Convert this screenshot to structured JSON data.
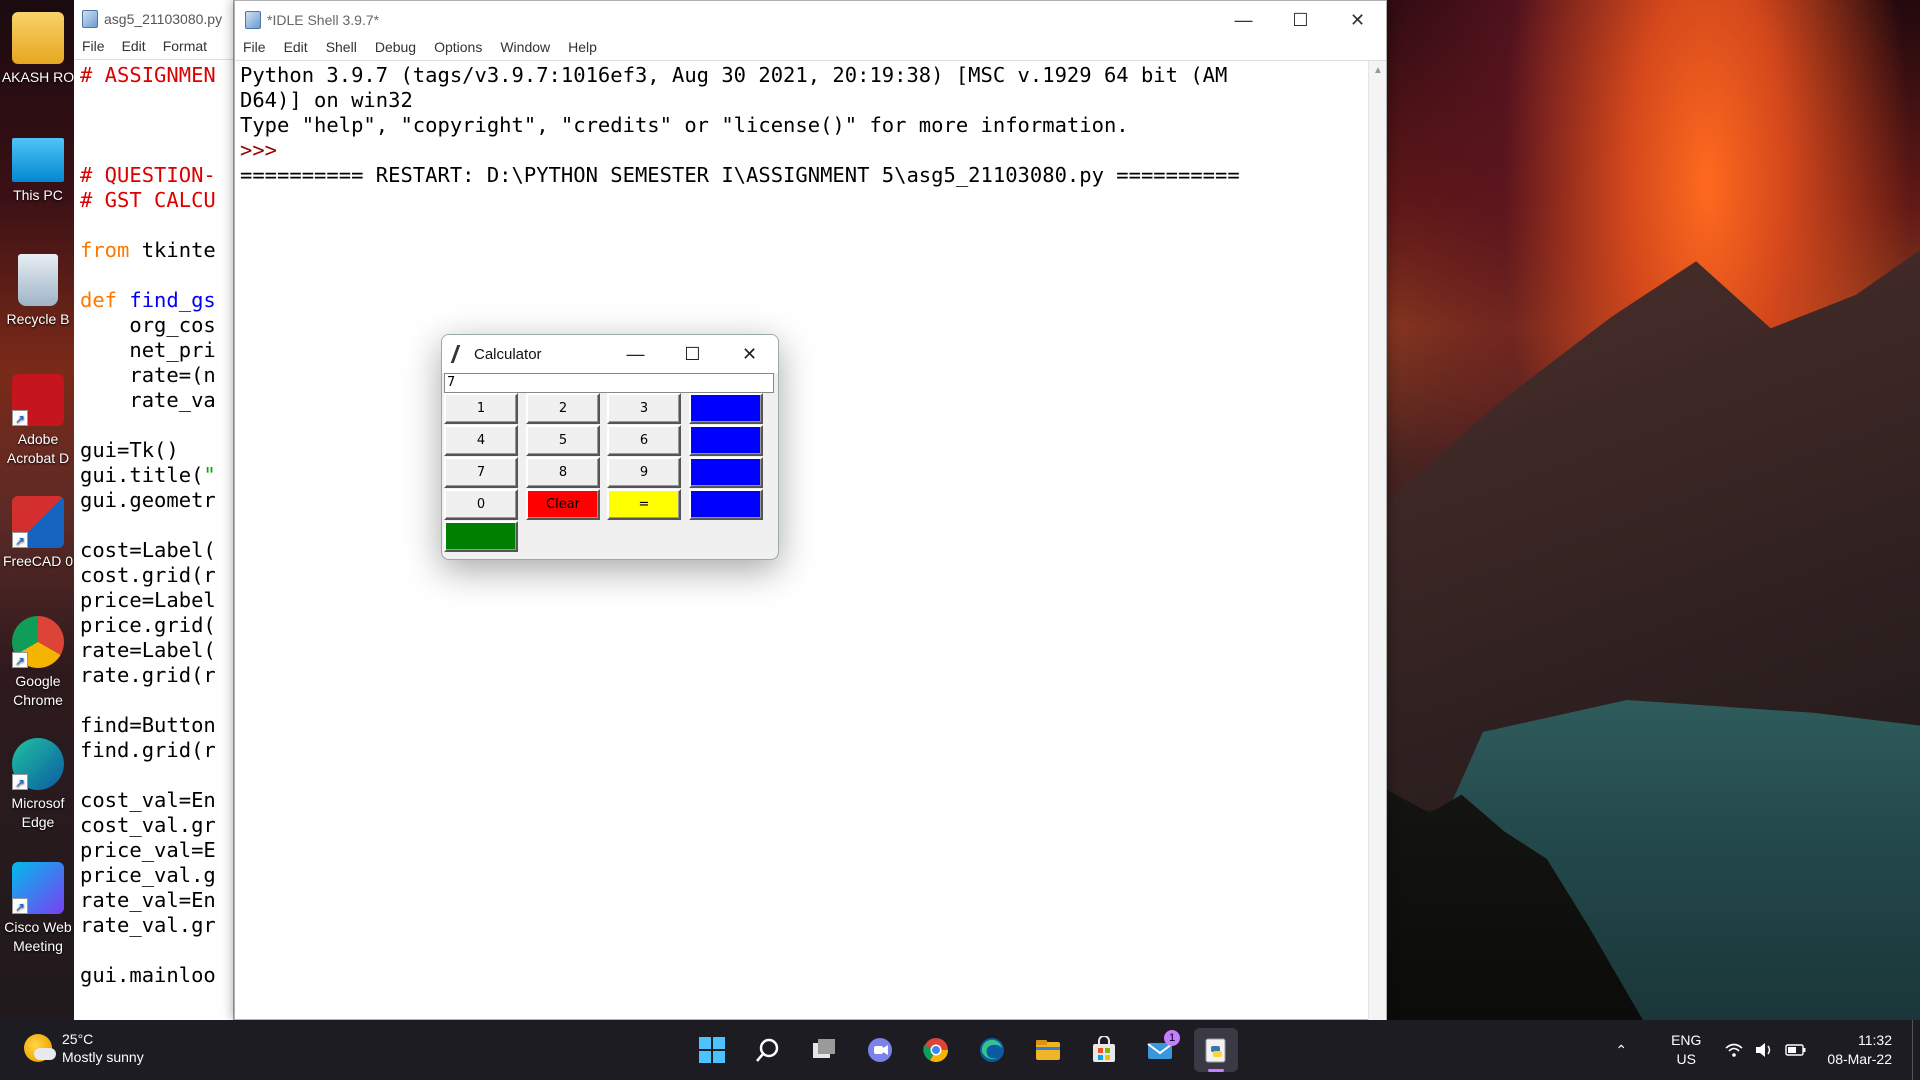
{
  "desktop": {
    "icons": [
      {
        "label": "AKASH RO",
        "icon": "user-folder-icon"
      },
      {
        "label": "This PC",
        "icon": "monitor-icon"
      },
      {
        "label": "Recycle B",
        "icon": "recycle-bin-icon"
      },
      {
        "label": "Adobe Acrobat D",
        "icon": "acrobat-icon"
      },
      {
        "label": "FreeCAD 0",
        "icon": "freecad-icon"
      },
      {
        "label": "Google Chrome",
        "icon": "chrome-icon"
      },
      {
        "label": "Microsof Edge",
        "icon": "edge-icon"
      },
      {
        "label": "Cisco Web Meeting",
        "icon": "webex-icon"
      }
    ]
  },
  "editor": {
    "title": "asg5_21103080.py",
    "menu": [
      "File",
      "Edit",
      "Format"
    ],
    "lines": [
      {
        "t": "# ASSIGNMEN",
        "c": "comment"
      },
      {
        "t": "",
        "c": "plain"
      },
      {
        "t": "",
        "c": "plain"
      },
      {
        "t": "",
        "c": "plain"
      },
      {
        "t": "# QUESTION-",
        "c": "comment"
      },
      {
        "t": "# GST CALCU",
        "c": "comment"
      },
      {
        "t": "",
        "c": "plain"
      },
      {
        "t": "from tkinte",
        "c": "kwfrom"
      },
      {
        "t": "",
        "c": "plain"
      },
      {
        "t": "def find_gs",
        "c": "def"
      },
      {
        "t": "    org_cos",
        "c": "plain"
      },
      {
        "t": "    net_pri",
        "c": "plain"
      },
      {
        "t": "    rate=(n",
        "c": "plain"
      },
      {
        "t": "    rate_va",
        "c": "plain"
      },
      {
        "t": "",
        "c": "plain"
      },
      {
        "t": "gui=Tk()",
        "c": "plain"
      },
      {
        "t": "gui.title(\"",
        "c": "strend"
      },
      {
        "t": "gui.geometr",
        "c": "plain"
      },
      {
        "t": "",
        "c": "plain"
      },
      {
        "t": "cost=Label(",
        "c": "plain"
      },
      {
        "t": "cost.grid(r",
        "c": "plain"
      },
      {
        "t": "price=Label",
        "c": "plain"
      },
      {
        "t": "price.grid(",
        "c": "plain"
      },
      {
        "t": "rate=Label(",
        "c": "plain"
      },
      {
        "t": "rate.grid(r",
        "c": "plain"
      },
      {
        "t": "",
        "c": "plain"
      },
      {
        "t": "find=Button",
        "c": "plain"
      },
      {
        "t": "find.grid(r",
        "c": "plain"
      },
      {
        "t": "",
        "c": "plain"
      },
      {
        "t": "cost_val=En",
        "c": "plain"
      },
      {
        "t": "cost_val.gr",
        "c": "plain"
      },
      {
        "t": "price_val=E",
        "c": "plain"
      },
      {
        "t": "price_val.g",
        "c": "plain"
      },
      {
        "t": "rate_val=En",
        "c": "plain"
      },
      {
        "t": "rate_val.gr",
        "c": "plain"
      },
      {
        "t": "",
        "c": "plain"
      },
      {
        "t": "gui.mainloo",
        "c": "plain"
      }
    ]
  },
  "shell": {
    "title": "*IDLE Shell 3.9.7*",
    "menu": [
      "File",
      "Edit",
      "Shell",
      "Debug",
      "Options",
      "Window",
      "Help"
    ],
    "line1": "Python 3.9.7 (tags/v3.9.7:1016ef3, Aug 30 2021, 20:19:38) [MSC v.1929 64 bit (AM",
    "line2": "D64)] on win32",
    "line3": "Type \"help\", \"copyright\", \"credits\" or \"license()\" for more information.",
    "prompt": ">>>",
    "restart": "========== RESTART: D:\\PYTHON SEMESTER I\\ASSIGNMENT 5\\asg5_21103080.py =========="
  },
  "calculator": {
    "title": "Calculator",
    "display": "7",
    "buttons": [
      {
        "label": "1",
        "style": "gray"
      },
      {
        "label": "2",
        "style": "gray"
      },
      {
        "label": "3",
        "style": "gray"
      },
      {
        "label": "+",
        "style": "blue"
      },
      {
        "label": "4",
        "style": "gray"
      },
      {
        "label": "5",
        "style": "gray"
      },
      {
        "label": "6",
        "style": "gray"
      },
      {
        "label": "-",
        "style": "blue"
      },
      {
        "label": "7",
        "style": "gray"
      },
      {
        "label": "8",
        "style": "gray"
      },
      {
        "label": "9",
        "style": "gray"
      },
      {
        "label": "*",
        "style": "blue"
      },
      {
        "label": "0",
        "style": "gray"
      },
      {
        "label": "Clear",
        "style": "red"
      },
      {
        "label": "=",
        "style": "yellow"
      },
      {
        "label": "/",
        "style": "blue"
      },
      {
        "label": ".",
        "style": "green"
      }
    ]
  },
  "taskbar": {
    "weather_temp": "25°C",
    "weather_desc": "Mostly sunny",
    "apps": [
      {
        "icon": "windows-start-icon"
      },
      {
        "icon": "search-icon"
      },
      {
        "icon": "task-view-icon"
      },
      {
        "icon": "teams-chat-icon"
      },
      {
        "icon": "chrome-icon"
      },
      {
        "icon": "edge-icon"
      },
      {
        "icon": "file-explorer-icon"
      },
      {
        "icon": "store-icon"
      },
      {
        "icon": "mail-icon",
        "badge": "1"
      },
      {
        "icon": "idle-python-icon",
        "active": true
      }
    ],
    "lang_top": "ENG",
    "lang_bottom": "US",
    "time": "11:32",
    "date": "08-Mar-22"
  },
  "colors": {
    "comment": "#dd0000",
    "keyword": "#ff7700",
    "defname": "#0000ff",
    "string": "#00aa00",
    "prompt": "#990000",
    "calc_blue": "#0000ff",
    "calc_red": "#ff0000",
    "calc_yellow": "#ffff00",
    "calc_green": "#008000"
  }
}
